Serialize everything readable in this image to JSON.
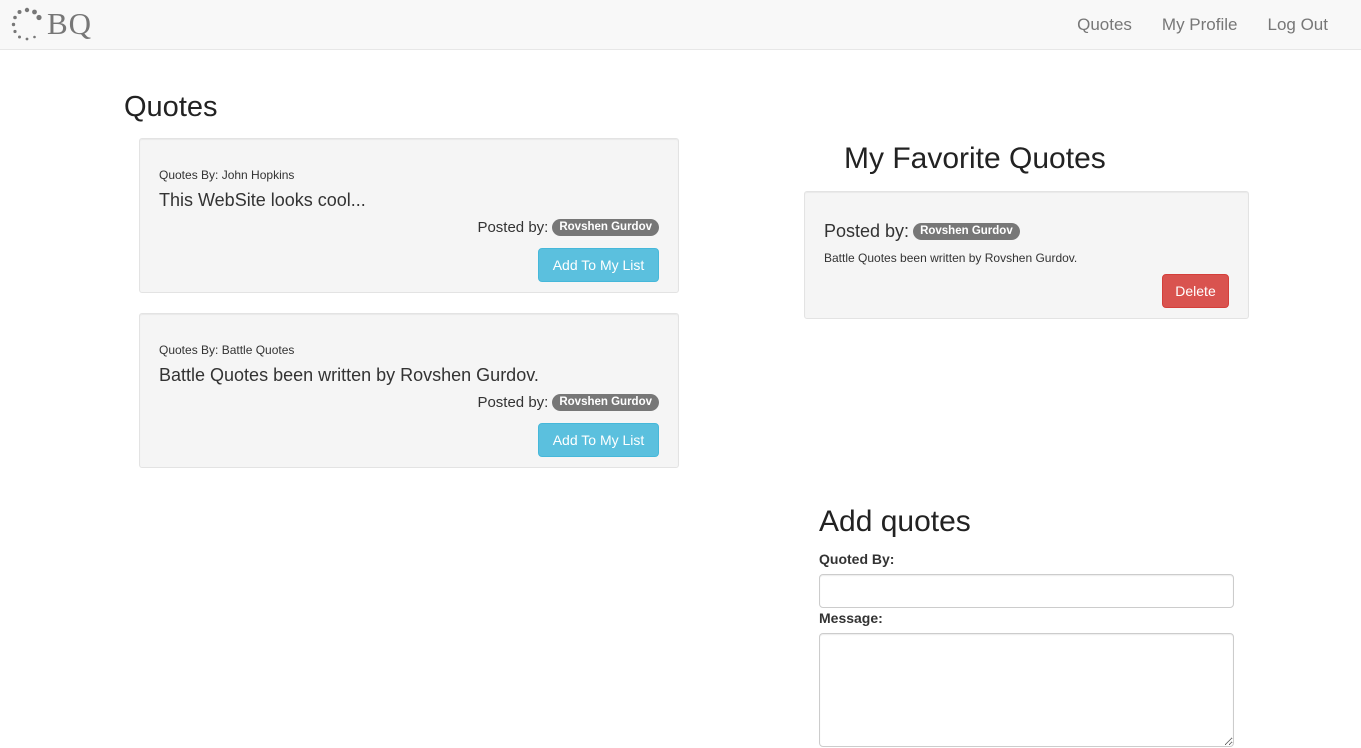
{
  "brand": {
    "text": "BQ"
  },
  "nav": {
    "items": [
      "Quotes",
      "My Profile",
      "Log Out"
    ]
  },
  "quotes_section": {
    "title": "Quotes",
    "cards": [
      {
        "quoted_by": "Quotes By: John Hopkins",
        "message": "This WebSite looks cool...",
        "posted_label": "Posted by:",
        "poster": "Rovshen Gurdov",
        "button": "Add To My List"
      },
      {
        "quoted_by": "Quotes By: Battle Quotes",
        "message": "Battle Quotes been written by Rovshen Gurdov.",
        "posted_label": "Posted by:",
        "poster": "Rovshen Gurdov",
        "button": "Add To My List"
      }
    ]
  },
  "favorites": {
    "title": "My Favorite Quotes",
    "items": [
      {
        "posted_label": "Posted by:",
        "poster": "Rovshen Gurdov",
        "message": "Battle Quotes been written by Rovshen Gurdov.",
        "button": "Delete"
      }
    ]
  },
  "add_form": {
    "title": "Add quotes",
    "quoted_by_label": "Quoted By:",
    "quoted_by_value": "",
    "message_label": "Message:",
    "message_value": ""
  },
  "colors": {
    "info": "#5bc0de",
    "danger": "#d9534f",
    "badge": "#777777",
    "navbar": "#f8f8f8"
  },
  "icons": {
    "brand_logo": "dotted-circle-logo-icon"
  }
}
